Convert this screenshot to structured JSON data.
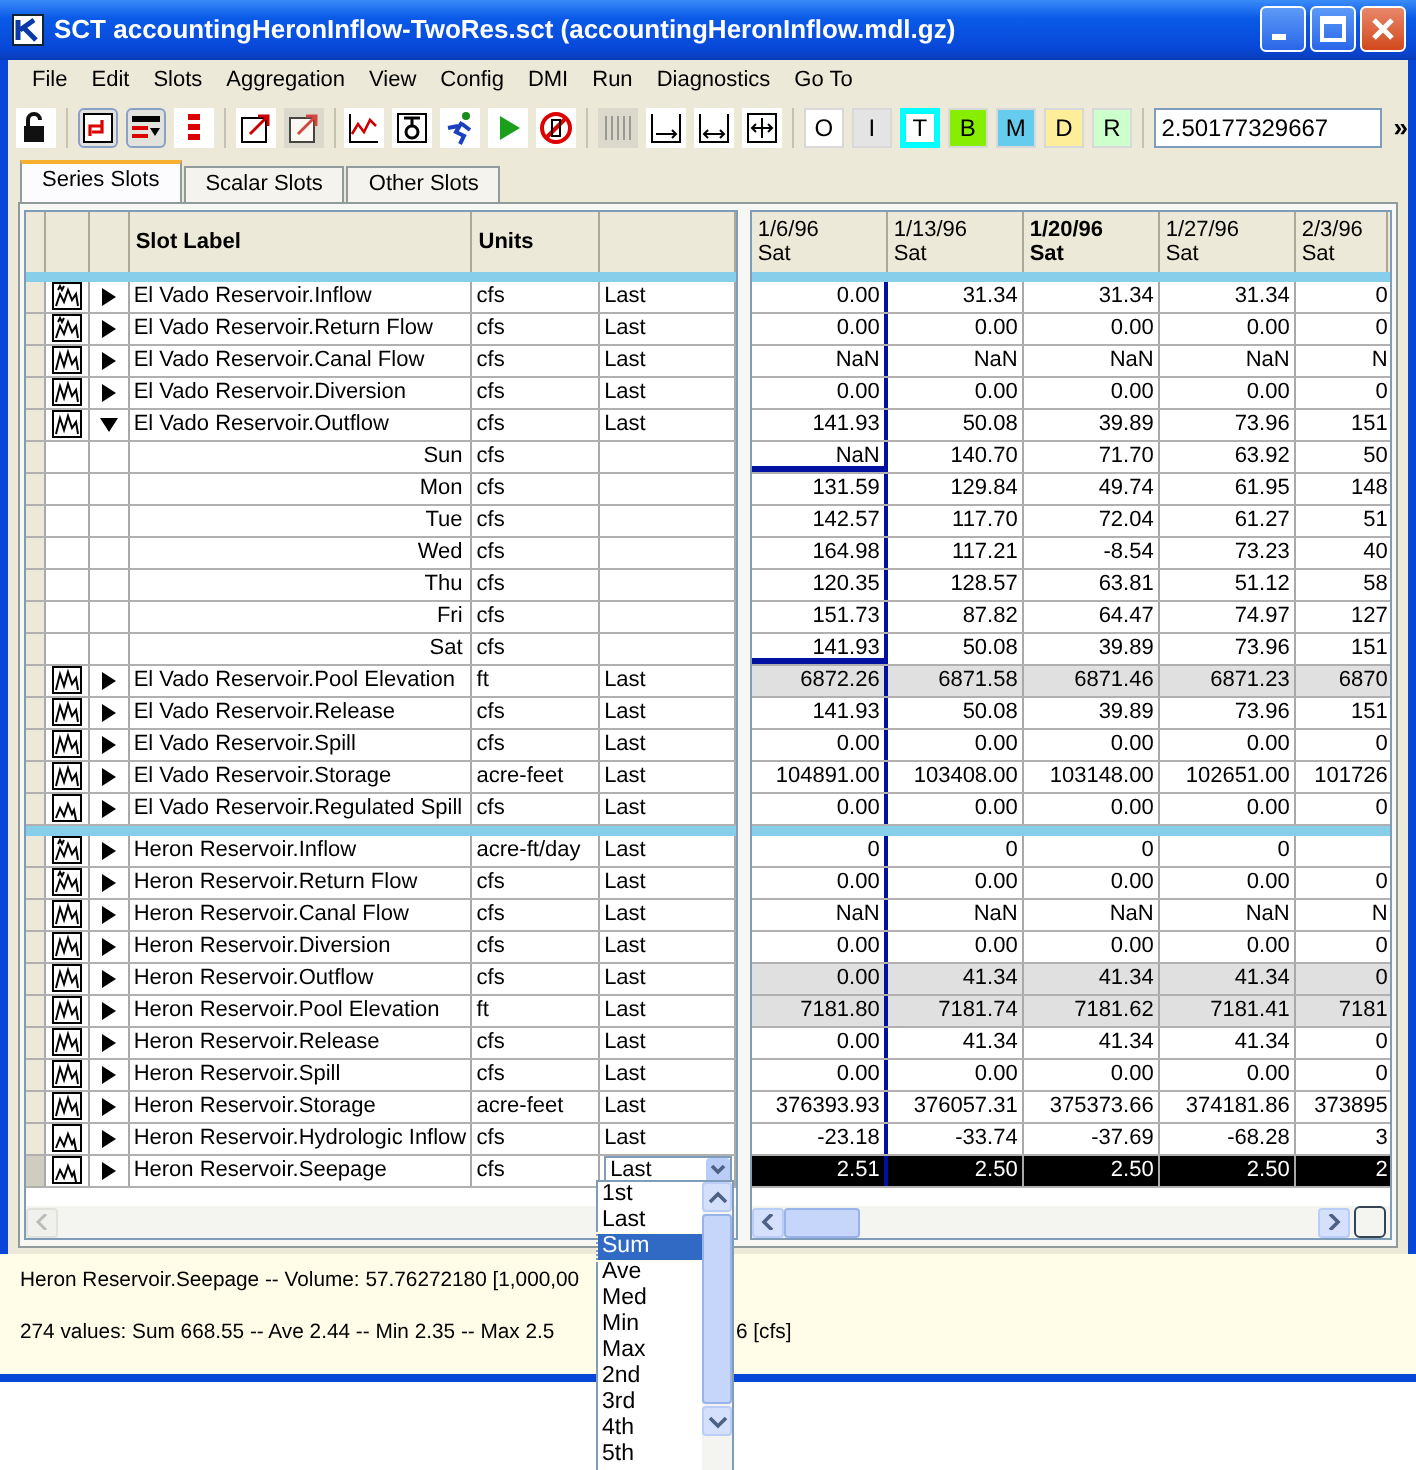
{
  "window": {
    "title": "SCT accountingHeronInflow-TwoRes.sct (accountingHeronInflow.mdl.gz)"
  },
  "menu": [
    "File",
    "Edit",
    "Slots",
    "Aggregation",
    "View",
    "Config",
    "DMI",
    "Run",
    "Diagnostics",
    "Go To"
  ],
  "toolbar": {
    "groups": [
      {
        "buttons": [
          {
            "kind": "lock",
            "pressed": false,
            "disabled": false
          }
        ]
      },
      {
        "buttons": [
          {
            "kind": "link-arrows",
            "pressed": true,
            "disabled": false
          },
          {
            "kind": "filter-rows",
            "pressed": true,
            "disabled": false
          },
          {
            "kind": "row-bars",
            "pressed": false,
            "disabled": false
          }
        ]
      },
      {
        "buttons": [
          {
            "kind": "popout",
            "pressed": false,
            "disabled": false
          },
          {
            "kind": "popout",
            "pressed": false,
            "disabled": true
          }
        ]
      },
      {
        "buttons": [
          {
            "kind": "chart",
            "pressed": false,
            "disabled": false
          },
          {
            "kind": "tool",
            "pressed": false,
            "disabled": false
          },
          {
            "kind": "runner",
            "pressed": false,
            "disabled": false
          },
          {
            "kind": "play",
            "pressed": false,
            "disabled": false
          },
          {
            "kind": "stop",
            "pressed": false,
            "disabled": false
          }
        ]
      },
      {
        "buttons": [
          {
            "kind": "columns",
            "pressed": false,
            "disabled": true
          },
          {
            "kind": "col-right",
            "pressed": false,
            "disabled": false
          },
          {
            "kind": "col-both",
            "pressed": false,
            "disabled": false
          },
          {
            "kind": "col-fit",
            "pressed": false,
            "disabled": false
          }
        ]
      }
    ],
    "color_buttons": [
      {
        "label": "O",
        "kind": "fill",
        "color": "#ffffff"
      },
      {
        "label": "I",
        "kind": "fill",
        "color": "#e4e4e4"
      },
      {
        "label": "T",
        "kind": "frame",
        "color": "#00ffff"
      },
      {
        "label": "B",
        "kind": "fill",
        "color": "#88ee00"
      },
      {
        "label": "M",
        "kind": "fill",
        "color": "#66ccee"
      },
      {
        "label": "D",
        "kind": "fill",
        "color": "#ffee99"
      },
      {
        "label": "R",
        "kind": "fill",
        "color": "#ccffcc"
      }
    ],
    "value": "2.50177329667",
    "overflow": "»"
  },
  "tabs": [
    {
      "label": "Series Slots",
      "selected": true
    },
    {
      "label": "Scalar Slots",
      "selected": false
    },
    {
      "label": "Other Slots",
      "selected": false
    }
  ],
  "table": {
    "headers": [
      "Slot Label",
      "Units"
    ],
    "columns": [
      {
        "date": "1/6/96",
        "day": "Sat",
        "current": false
      },
      {
        "date": "1/13/96",
        "day": "Sat",
        "current": false
      },
      {
        "date": "1/20/96",
        "day": "Sat",
        "current": true
      },
      {
        "date": "1/27/96",
        "day": "Sat",
        "current": false
      },
      {
        "date": "2/3/96",
        "day": "Sat",
        "current": false
      }
    ],
    "groups": [
      {
        "slots": [
          {
            "kind": "multi",
            "label": "El Vado Reservoir.Inflow",
            "units": "cfs",
            "aggregation": "Last",
            "expanded": false,
            "shaded": false,
            "selected": false,
            "values": [
              "0.00",
              "31.34",
              "31.34",
              "31.34",
              "0"
            ]
          },
          {
            "kind": "multi",
            "label": "El Vado Reservoir.Return Flow",
            "units": "cfs",
            "aggregation": "Last",
            "expanded": false,
            "shaded": false,
            "selected": false,
            "values": [
              "0.00",
              "0.00",
              "0.00",
              "0.00",
              "0"
            ]
          },
          {
            "kind": "series",
            "label": "El Vado Reservoir.Canal Flow",
            "units": "cfs",
            "aggregation": "Last",
            "expanded": false,
            "shaded": false,
            "selected": false,
            "values": [
              "NaN",
              "NaN",
              "NaN",
              "NaN",
              "N"
            ]
          },
          {
            "kind": "series",
            "label": "El Vado Reservoir.Diversion",
            "units": "cfs",
            "aggregation": "Last",
            "expanded": false,
            "shaded": false,
            "selected": false,
            "values": [
              "0.00",
              "0.00",
              "0.00",
              "0.00",
              "0"
            ]
          },
          {
            "kind": "series",
            "label": "El Vado Reservoir.Outflow",
            "units": "cfs",
            "aggregation": "Last",
            "expanded": true,
            "shaded": false,
            "selected": false,
            "values": [
              "141.93",
              "50.08",
              "39.89",
              "73.96",
              "151"
            ],
            "children": [
              {
                "label": "Sun",
                "units": "cfs",
                "values": [
                  "NaN",
                  "140.70",
                  "71.70",
                  "63.92",
                  "50"
                ]
              },
              {
                "label": "Mon",
                "units": "cfs",
                "values": [
                  "131.59",
                  "129.84",
                  "49.74",
                  "61.95",
                  "148"
                ]
              },
              {
                "label": "Tue",
                "units": "cfs",
                "values": [
                  "142.57",
                  "117.70",
                  "72.04",
                  "61.27",
                  "51"
                ]
              },
              {
                "label": "Wed",
                "units": "cfs",
                "values": [
                  "164.98",
                  "117.21",
                  "-8.54",
                  "73.23",
                  "40"
                ]
              },
              {
                "label": "Thu",
                "units": "cfs",
                "values": [
                  "120.35",
                  "128.57",
                  "63.81",
                  "51.12",
                  "58"
                ]
              },
              {
                "label": "Fri",
                "units": "cfs",
                "values": [
                  "151.73",
                  "87.82",
                  "64.47",
                  "74.97",
                  "127"
                ]
              },
              {
                "label": "Sat",
                "units": "cfs",
                "values": [
                  "141.93",
                  "50.08",
                  "39.89",
                  "73.96",
                  "151"
                ]
              }
            ]
          },
          {
            "kind": "series",
            "label": "El Vado Reservoir.Pool Elevation",
            "units": "ft",
            "aggregation": "Last",
            "expanded": false,
            "shaded": true,
            "selected": false,
            "values": [
              "6872.26",
              "6871.58",
              "6871.46",
              "6871.23",
              "6870"
            ]
          },
          {
            "kind": "series",
            "label": "El Vado Reservoir.Release",
            "units": "cfs",
            "aggregation": "Last",
            "expanded": false,
            "shaded": false,
            "selected": false,
            "values": [
              "141.93",
              "50.08",
              "39.89",
              "73.96",
              "151"
            ]
          },
          {
            "kind": "series",
            "label": "El Vado Reservoir.Spill",
            "units": "cfs",
            "aggregation": "Last",
            "expanded": false,
            "shaded": false,
            "selected": false,
            "values": [
              "0.00",
              "0.00",
              "0.00",
              "0.00",
              "0"
            ]
          },
          {
            "kind": "series",
            "label": "El Vado Reservoir.Storage",
            "units": "acre-feet",
            "aggregation": "Last",
            "expanded": false,
            "shaded": false,
            "selected": false,
            "values": [
              "104891.00",
              "103408.00",
              "103148.00",
              "102651.00",
              "101726"
            ]
          },
          {
            "kind": "plain",
            "label": "El Vado Reservoir.Regulated Spill",
            "units": "cfs",
            "aggregation": "Last",
            "expanded": false,
            "shaded": false,
            "selected": false,
            "values": [
              "0.00",
              "0.00",
              "0.00",
              "0.00",
              "0"
            ]
          }
        ]
      },
      {
        "slots": [
          {
            "kind": "multi",
            "label": "Heron Reservoir.Inflow",
            "units": "acre-ft/day",
            "aggregation": "Last",
            "expanded": false,
            "shaded": false,
            "selected": false,
            "values": [
              "0",
              "0",
              "0",
              "0"
            ]
          },
          {
            "kind": "multi",
            "label": "Heron Reservoir.Return Flow",
            "units": "cfs",
            "aggregation": "Last",
            "expanded": false,
            "shaded": false,
            "selected": false,
            "values": [
              "0.00",
              "0.00",
              "0.00",
              "0.00",
              "0"
            ]
          },
          {
            "kind": "series",
            "label": "Heron Reservoir.Canal Flow",
            "units": "cfs",
            "aggregation": "Last",
            "expanded": false,
            "shaded": false,
            "selected": false,
            "values": [
              "NaN",
              "NaN",
              "NaN",
              "NaN",
              "N"
            ]
          },
          {
            "kind": "series",
            "label": "Heron Reservoir.Diversion",
            "units": "cfs",
            "aggregation": "Last",
            "expanded": false,
            "shaded": false,
            "selected": false,
            "values": [
              "0.00",
              "0.00",
              "0.00",
              "0.00",
              "0"
            ]
          },
          {
            "kind": "series",
            "label": "Heron Reservoir.Outflow",
            "units": "cfs",
            "aggregation": "Last",
            "expanded": false,
            "shaded": true,
            "selected": false,
            "values": [
              "0.00",
              "41.34",
              "41.34",
              "41.34",
              "0"
            ]
          },
          {
            "kind": "series",
            "label": "Heron Reservoir.Pool Elevation",
            "units": "ft",
            "aggregation": "Last",
            "expanded": false,
            "shaded": true,
            "selected": false,
            "values": [
              "7181.80",
              "7181.74",
              "7181.62",
              "7181.41",
              "7181"
            ]
          },
          {
            "kind": "series",
            "label": "Heron Reservoir.Release",
            "units": "cfs",
            "aggregation": "Last",
            "expanded": false,
            "shaded": false,
            "selected": false,
            "values": [
              "0.00",
              "41.34",
              "41.34",
              "41.34",
              "0"
            ]
          },
          {
            "kind": "series",
            "label": "Heron Reservoir.Spill",
            "units": "cfs",
            "aggregation": "Last",
            "expanded": false,
            "shaded": false,
            "selected": false,
            "values": [
              "0.00",
              "0.00",
              "0.00",
              "0.00",
              "0"
            ]
          },
          {
            "kind": "series",
            "label": "Heron Reservoir.Storage",
            "units": "acre-feet",
            "aggregation": "Last",
            "expanded": false,
            "shaded": false,
            "selected": false,
            "values": [
              "376393.93",
              "376057.31",
              "375373.66",
              "374181.86",
              "373895"
            ]
          },
          {
            "kind": "plain",
            "label": "Heron Reservoir.Hydrologic Inflow",
            "units": "cfs",
            "aggregation": "Last",
            "expanded": false,
            "shaded": false,
            "selected": false,
            "values": [
              "-23.18",
              "-33.74",
              "-37.69",
              "-68.28",
              "3"
            ]
          },
          {
            "kind": "plain",
            "label": "Heron Reservoir.Seepage",
            "units": "cfs",
            "aggregation": "Last",
            "expanded": false,
            "shaded": false,
            "selected": true,
            "values": [
              "2.51",
              "2.50",
              "2.50",
              "2.50",
              "2"
            ]
          }
        ]
      }
    ]
  },
  "aggregation_dropdown": {
    "options": [
      {
        "label": "1st",
        "selected": false
      },
      {
        "label": "Last",
        "selected": false
      },
      {
        "label": "Sum",
        "selected": true
      },
      {
        "label": "Ave",
        "selected": false
      },
      {
        "label": "Med",
        "selected": false
      },
      {
        "label": "Min",
        "selected": false
      },
      {
        "label": "Max",
        "selected": false
      },
      {
        "label": "2nd",
        "selected": false
      },
      {
        "label": "3rd",
        "selected": false
      },
      {
        "label": "4th",
        "selected": false
      },
      {
        "label": "5th",
        "selected": false
      }
    ]
  },
  "status": {
    "line_1": "Heron Reservoir.Seepage -- Volume: 57.76272180 [1,000,00",
    "line_2": "274 values:  Sum 668.55 -- Ave 2.44 -- Min 2.35 -- Max 2.5",
    "line_2_end": "6 [cfs]"
  }
}
